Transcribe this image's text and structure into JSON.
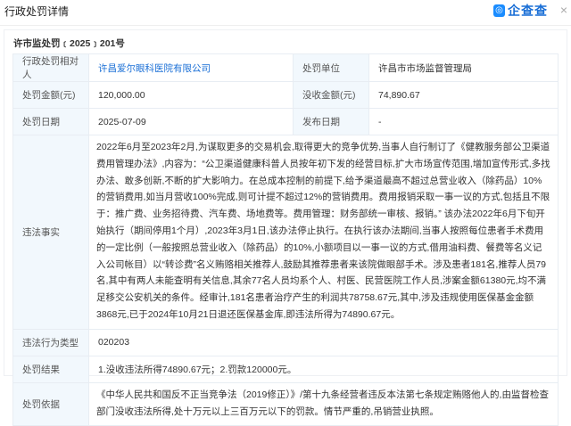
{
  "header": {
    "title": "行政处罚详情",
    "logo": "企查查",
    "close": "×"
  },
  "doc_number": "许市监处罚﹝2025﹞201号",
  "rows": {
    "party_label": "行政处罚相对人",
    "party_value": "许昌爱尔眼科医院有限公司",
    "unit_label": "处罚单位",
    "unit_value": "许昌市市场监督管理局",
    "fine_label": "处罚金额(元)",
    "fine_value": "120,000.00",
    "confiscate_label": "没收金额(元)",
    "confiscate_value": "74,890.67",
    "date_label": "处罚日期",
    "date_value": "2025-07-09",
    "publish_label": "发布日期",
    "publish_value": "-",
    "facts_label": "违法事实",
    "facts_value": "2022年6月至2023年2月,为谋取更多的交易机会,取得更大的竞争优势,当事人自行制订了《健教服务部公卫渠道费用管理办法》,内容为：“公卫渠道健康科普人员按年初下发的经营目标,扩大市场宣传范围,增加宣传形式,多找办法、敢多创新,不断的扩大影响力。在总成本控制的前提下,给予渠道最高不超过总营业收入（除药品）10%的营销费用,如当月营收100%完成,则可计提不超过12%的营销费用。费用报销采取一事一议的方式,包括且不限于：推广费、业务招待费、汽车费、场地费等。费用管理：财务部统一审核、报销。” 该办法2022年6月下旬开始执行（期间停用1个月）,2023年3月1日,该办法停止执行。在执行该办法期间,当事人按照每位患者手术费用的一定比例（一般按照总营业收入（除药品）的10%,小额项目以一事一议的方式,借用油料费、餐费等名义记入公司帐目）以“转诊费”名义贿赂相关推荐人,鼓励其推荐患者来该院做眼部手术。涉及患者181名,推荐人员79名,其中有两人未能查明有关信息,其余77名人员均系个人、村医、民营医院工作人员,涉案金额61380元,均不满足移交公安机关的条件。经审计,181名患者治疗产生的利润共78758.67元,其中,涉及违规使用医保基金金额3868元,已于2024年10月21日退还医保基金库,即违法所得为74890.67元。",
    "type_label": "违法行为类型",
    "type_value": "020203",
    "result_label": "处罚结果",
    "result_value": "1.没收违法所得74890.67元；2.罚款120000元。",
    "basis_label": "处罚依据",
    "basis_value": "《中华人民共和国反不正当竞争法（2019修正）》/第十九条经营者违反本法第七条规定贿赂他人的,由监督检查部门没收违法所得,处十万元以上三百万元以下的罚款。情节严重的,吊销营业执照。"
  }
}
